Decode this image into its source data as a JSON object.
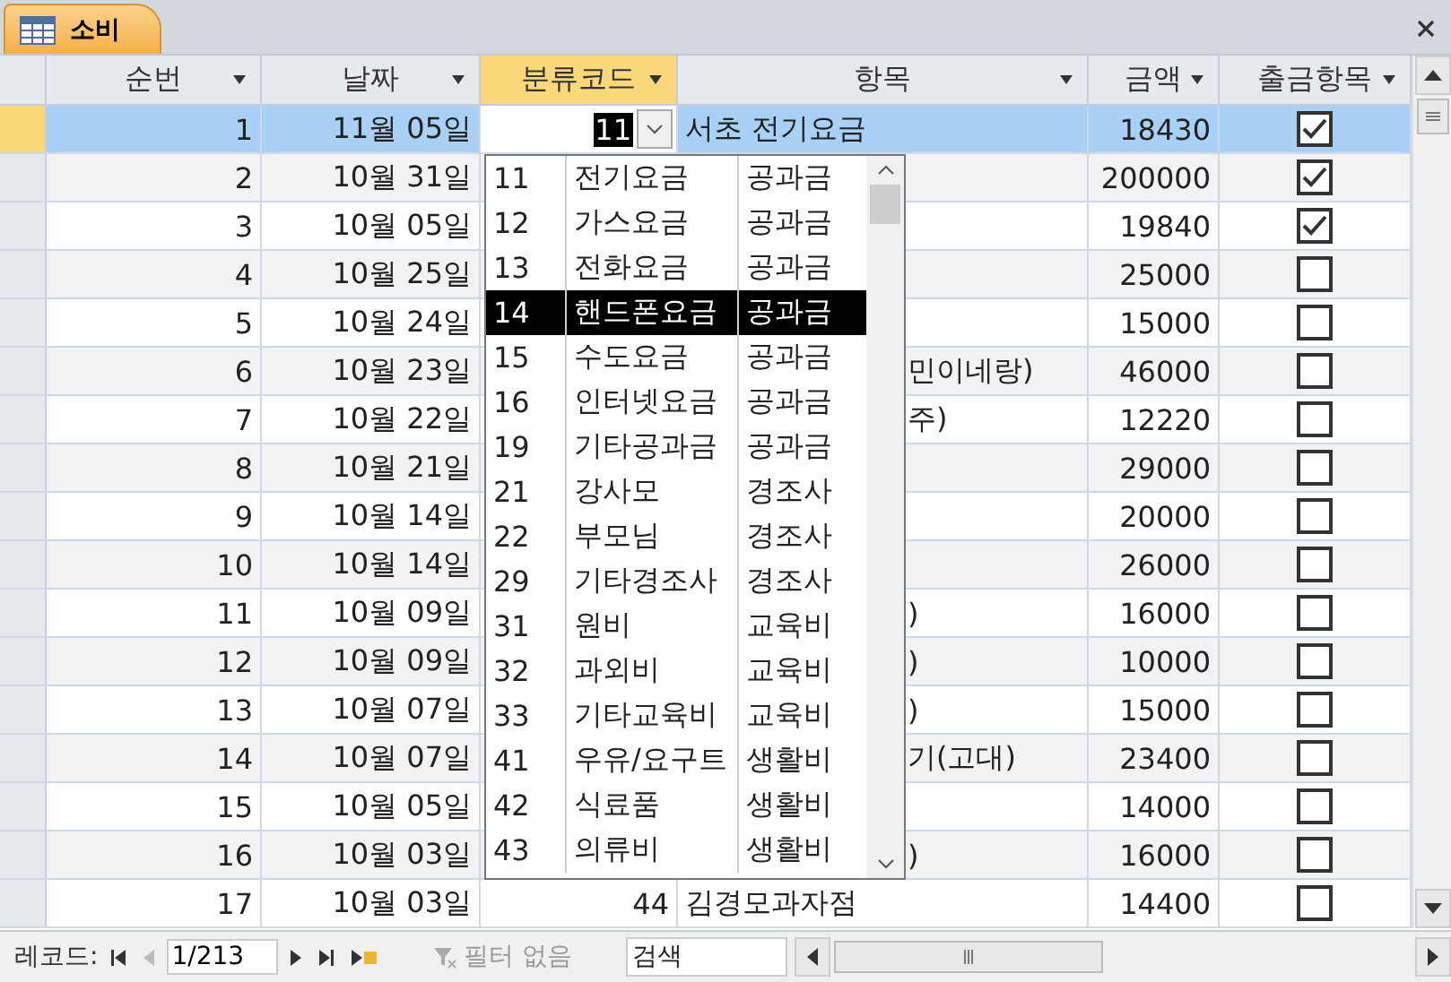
{
  "tab": {
    "title": "소비"
  },
  "columns": [
    {
      "label": "순번",
      "selected": false
    },
    {
      "label": "날짜",
      "selected": false
    },
    {
      "label": "분류코드",
      "selected": true
    },
    {
      "label": "항목",
      "selected": false
    },
    {
      "label": "금액",
      "selected": false
    },
    {
      "label": "출금항목",
      "selected": false
    }
  ],
  "rows": [
    {
      "no": "1",
      "date": "11월 05일",
      "code": "11",
      "item": "서초 전기요금",
      "covered": false,
      "amount": "18430",
      "checked": true,
      "selected": true
    },
    {
      "no": "2",
      "date": "10월 31일",
      "amount": "200000",
      "checked": true,
      "selected": false
    },
    {
      "no": "3",
      "date": "10월 05일",
      "amount": "19840",
      "checked": true,
      "selected": false
    },
    {
      "no": "4",
      "date": "10월 25일",
      "amount": "25000",
      "checked": false,
      "selected": false
    },
    {
      "no": "5",
      "date": "10월 24일",
      "amount": "15000",
      "checked": false,
      "selected": false
    },
    {
      "no": "6",
      "date": "10월 23일",
      "item": "민이네랑)",
      "covered": true,
      "amount": "46000",
      "checked": false,
      "selected": false
    },
    {
      "no": "7",
      "date": "10월 22일",
      "item": "주)",
      "covered": true,
      "amount": "12220",
      "checked": false,
      "selected": false
    },
    {
      "no": "8",
      "date": "10월 21일",
      "amount": "29000",
      "checked": false,
      "selected": false
    },
    {
      "no": "9",
      "date": "10월 14일",
      "amount": "20000",
      "checked": false,
      "selected": false
    },
    {
      "no": "10",
      "date": "10월 14일",
      "amount": "26000",
      "checked": false,
      "selected": false
    },
    {
      "no": "11",
      "date": "10월 09일",
      "item": ")",
      "covered": true,
      "amount": "16000",
      "checked": false,
      "selected": false
    },
    {
      "no": "12",
      "date": "10월 09일",
      "item": ")",
      "covered": true,
      "amount": "10000",
      "checked": false,
      "selected": false
    },
    {
      "no": "13",
      "date": "10월 07일",
      "item": ")",
      "covered": true,
      "amount": "15000",
      "checked": false,
      "selected": false
    },
    {
      "no": "14",
      "date": "10월 07일",
      "item": "기(고대)",
      "covered": true,
      "amount": "23400",
      "checked": false,
      "selected": false
    },
    {
      "no": "15",
      "date": "10월 05일",
      "amount": "14000",
      "checked": false,
      "selected": false
    },
    {
      "no": "16",
      "date": "10월 03일",
      "item": ")",
      "covered": true,
      "amount": "16000",
      "checked": false,
      "selected": false
    },
    {
      "no": "17",
      "date": "10월 03일",
      "code": "44",
      "item": "김경모과자점",
      "covered": false,
      "amount": "14400",
      "checked": false,
      "selected": false
    }
  ],
  "dropdown": [
    {
      "code": "11",
      "name": "전기요금",
      "group": "공과금",
      "selected": false
    },
    {
      "code": "12",
      "name": "가스요금",
      "group": "공과금",
      "selected": false
    },
    {
      "code": "13",
      "name": "전화요금",
      "group": "공과금",
      "selected": false
    },
    {
      "code": "14",
      "name": "핸드폰요금",
      "group": "공과금",
      "selected": true
    },
    {
      "code": "15",
      "name": "수도요금",
      "group": "공과금",
      "selected": false
    },
    {
      "code": "16",
      "name": "인터넷요금",
      "group": "공과금",
      "selected": false
    },
    {
      "code": "19",
      "name": "기타공과금",
      "group": "공과금",
      "selected": false
    },
    {
      "code": "21",
      "name": "강사모",
      "group": "경조사",
      "selected": false
    },
    {
      "code": "22",
      "name": "부모님",
      "group": "경조사",
      "selected": false
    },
    {
      "code": "29",
      "name": "기타경조사",
      "group": "경조사",
      "selected": false
    },
    {
      "code": "31",
      "name": "원비",
      "group": "교육비",
      "selected": false
    },
    {
      "code": "32",
      "name": "과외비",
      "group": "교육비",
      "selected": false
    },
    {
      "code": "33",
      "name": "기타교육비",
      "group": "교육비",
      "selected": false
    },
    {
      "code": "41",
      "name": "우유/요구트",
      "group": "생활비",
      "selected": false
    },
    {
      "code": "42",
      "name": "식료품",
      "group": "생활비",
      "selected": false
    },
    {
      "code": "43",
      "name": "의류비",
      "group": "생활비",
      "selected": false
    }
  ],
  "status_bar": {
    "record_label": "레코드:",
    "record": "1/213",
    "filter": "필터 없음",
    "filter_disabled": true,
    "search_placeholder": "검색"
  }
}
